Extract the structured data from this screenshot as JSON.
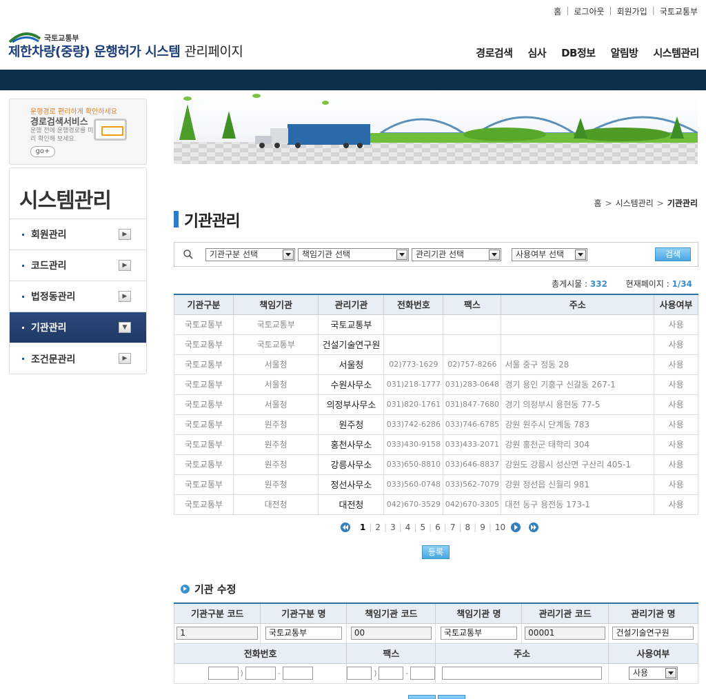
{
  "util_nav": [
    "홈",
    "로그아웃",
    "회원가입",
    "국토교통부"
  ],
  "logo": {
    "ministry": "국토교통부",
    "title": "제한차량(중량) 운행허가 시스템",
    "suffix": "관리페이지"
  },
  "gnb": [
    "경로검색",
    "심사",
    "DB정보",
    "알림방",
    "시스템관리"
  ],
  "promo": {
    "line1": "운행경로 편리하게 확인하세요",
    "line2": "경로검색서비스",
    "line3": "운행 전에 운행경로를 미리 확인해 보세요.",
    "go": "go+"
  },
  "sidebar": {
    "title": "시스템관리",
    "items": [
      {
        "label": "회원관리",
        "active": false
      },
      {
        "label": "코드관리",
        "active": false
      },
      {
        "label": "법정동관리",
        "active": false
      },
      {
        "label": "기관관리",
        "active": true
      },
      {
        "label": "조건문관리",
        "active": false
      }
    ]
  },
  "breadcrumb": [
    "홈",
    "시스템관리",
    "기관관리"
  ],
  "page_title": "기관관리",
  "search": {
    "selects": [
      "기관구분 선택",
      "책임기관 선택",
      "관리기관 선택",
      "사용여부 선택"
    ],
    "button": "검색"
  },
  "totals": {
    "count_label": "총게시물 :",
    "count": "332",
    "page_label": "현재페이지 :",
    "page": "1/34"
  },
  "list": {
    "headers": [
      "기관구분",
      "책임기관",
      "관리기관",
      "전화번호",
      "팩스",
      "주소",
      "사용여부"
    ],
    "rows": [
      [
        "국토교통부",
        "국토교통부",
        "국토교통부",
        "",
        "",
        "",
        "사용"
      ],
      [
        "국토교통부",
        "국토교통부",
        "건설기술연구원",
        "",
        "",
        "",
        "사용"
      ],
      [
        "국토교통부",
        "서울청",
        "서울청",
        "02)773-1629",
        "02)757-8266",
        "서울 중구 정동 28",
        "사용"
      ],
      [
        "국토교통부",
        "서울청",
        "수원사무소",
        "031)218-1777",
        "031)283-0648",
        "경기 용인 기흥구 신갈동 267-1",
        "사용"
      ],
      [
        "국토교통부",
        "서울청",
        "의정부사무소",
        "031)820-1761",
        "031)847-7680",
        "경기 의정부시 용현동 77-5",
        "사용"
      ],
      [
        "국토교통부",
        "원주청",
        "원주청",
        "033)742-6286",
        "033)746-6785",
        "강원 원주시 단계동 783",
        "사용"
      ],
      [
        "국토교통부",
        "원주청",
        "홍천사무소",
        "033)430-9158",
        "033)433-2071",
        "강원 홍천군 태학리 304",
        "사용"
      ],
      [
        "국토교통부",
        "원주청",
        "강릉사무소",
        "033)650-8810",
        "033)646-8837",
        "강원도 강릉시 성산면 구산리 405-1",
        "사용"
      ],
      [
        "국토교통부",
        "원주청",
        "정선사무소",
        "033)560-0748",
        "033)562-7079",
        "강원 정선읍 신월리 981",
        "사용"
      ],
      [
        "국토교통부",
        "대전청",
        "대전청",
        "042)670-3529",
        "042)670-3305",
        "대전 동구 용전동 173-1",
        "사용"
      ]
    ]
  },
  "pager": {
    "pages": [
      "1",
      "2",
      "3",
      "4",
      "5",
      "6",
      "7",
      "8",
      "9",
      "10"
    ],
    "current": "1"
  },
  "register_button": "등록",
  "edit": {
    "title": "기관 수정",
    "headers1": [
      "기관구분 코드",
      "기관구분 명",
      "책임기관 코드",
      "책임기관 명",
      "관리기관 코드",
      "관리기관 명"
    ],
    "values1": [
      "1",
      "국토교통부",
      "00",
      "국토교통부",
      "00001",
      "건설기술연구원"
    ],
    "headers2": [
      "전화번호",
      "팩스",
      "주소",
      "사용여부"
    ],
    "use_value": "사용",
    "phone_sep": ")",
    "dash": "-"
  },
  "colors": {
    "navbar": "#0e2f4c",
    "accent": "#2b7ccb",
    "active_menu": "#1f3864",
    "button": "#4aa6e3",
    "count": "#3a8fd0"
  }
}
